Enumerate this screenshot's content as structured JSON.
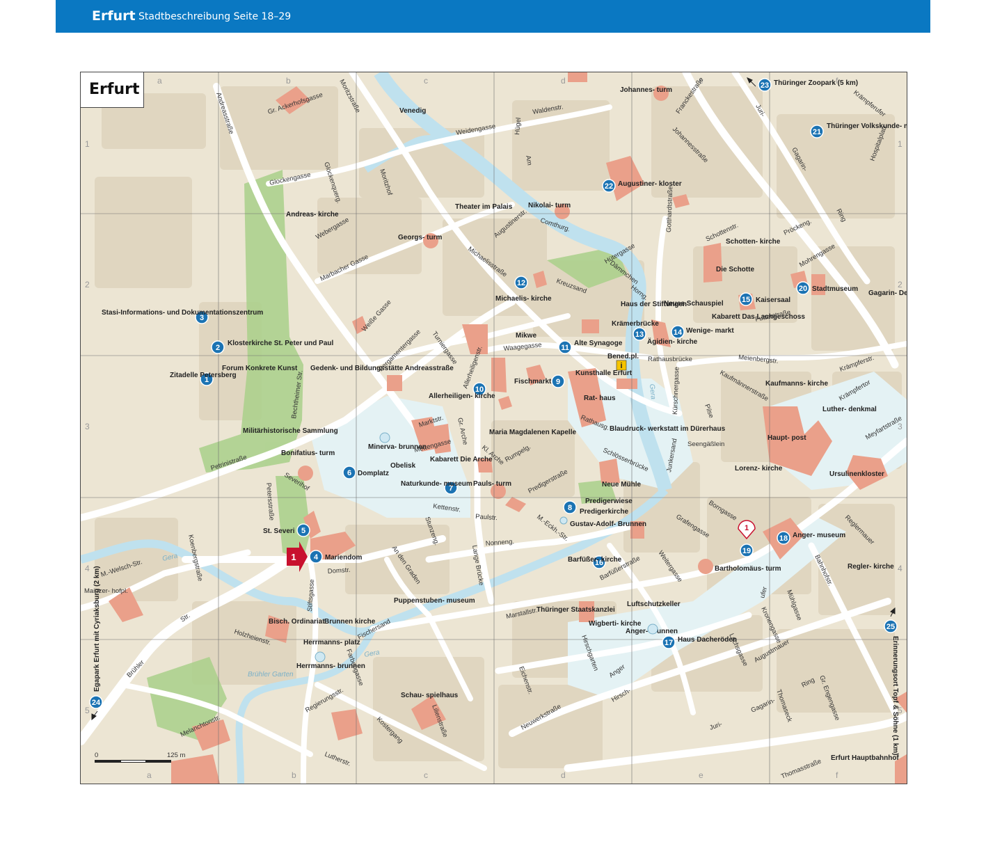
{
  "header": {
    "city": "Erfurt",
    "subtitle": "Stadtbeschreibung Seite 18–29"
  },
  "map": {
    "title": "Erfurt",
    "grid_columns": [
      "a",
      "b",
      "c",
      "d",
      "e",
      "f"
    ],
    "grid_rows": [
      "1",
      "2",
      "3",
      "4",
      "5"
    ],
    "scale": {
      "zero": "0",
      "max": "125 m"
    },
    "poi": [
      {
        "n": "1",
        "label": "Zitadelle Petersberg"
      },
      {
        "n": "2",
        "label": "Klosterkirche St. Peter und Paul"
      },
      {
        "n": "3",
        "label": "Stasi-Informations- und Dokumentationszentrum"
      },
      {
        "n": "4",
        "label": "Mariendom"
      },
      {
        "n": "5",
        "label": "St. Severi"
      },
      {
        "n": "6",
        "label": "Domplatz"
      },
      {
        "n": "7",
        "label": "Naturkunde- museum"
      },
      {
        "n": "8",
        "label": "Predigerkirche"
      },
      {
        "n": "9",
        "label": "Fischmarkt"
      },
      {
        "n": "10",
        "label": "Allerheiligen- kirche"
      },
      {
        "n": "11",
        "label": "Alte Synagoge"
      },
      {
        "n": "12",
        "label": "Michaelis- kirche"
      },
      {
        "n": "13",
        "label": "Krämerbrücke"
      },
      {
        "n": "14",
        "label": "Wenige- markt"
      },
      {
        "n": "15",
        "label": "Kaisersaal"
      },
      {
        "n": "16",
        "label": "Barfüßer- kirche"
      },
      {
        "n": "17",
        "label": "Haus Dacheröden"
      },
      {
        "n": "18",
        "label": "Anger- museum"
      },
      {
        "n": "19",
        "label": ""
      },
      {
        "n": "20",
        "label": "Stadtmuseum"
      },
      {
        "n": "21",
        "label": "Thüringer Volkskunde- museum"
      },
      {
        "n": "22",
        "label": "Augustiner- kloster"
      },
      {
        "n": "23",
        "label": "Thüringer Zoopark (5 km)"
      },
      {
        "n": "24",
        "label": "Egapark Erfurt mit Cyriaksburg (2 km)"
      },
      {
        "n": "25",
        "label": "Erinnerungsort Topf & Söhne (1 km)"
      }
    ],
    "places": {
      "venedig": "Venedig",
      "theater": "Theater im Palais",
      "andreaskirche": "Andreas- kirche",
      "georgsturm": "Georgs- turm",
      "nikolaiturm": "Nikolai- turm",
      "johannesturm": "Johannes- turm",
      "schottenkirche": "Schotten- kirche",
      "dieschotte": "Die Schotte",
      "hausstiftungen": "Haus der Stiftungen",
      "neuesschauspiel": "Neues Schauspiel",
      "kabarett": "Kabarett Das Lachgeschoss",
      "aegidien": "Ägidien- kirche",
      "mikwe": "Mikwe",
      "benedpl": "Bened.pl.",
      "kunsthalle": "Kunsthalle Erfurt",
      "rathaus": "Rat- haus",
      "blaudruck": "Blaudruck- werkstatt im Dürerhaus",
      "forum": "Forum Konkrete Kunst",
      "gedenk": "Gedenk- und Bildungsstätte Andreasstraße",
      "militaer": "Militärhistorische Sammlung",
      "bonifatius": "Bonifatius- turm",
      "minerva": "Minerva- brunnen",
      "obelisk": "Obelisk",
      "kabarettarche": "Kabarett Die Arche",
      "magdalenen": "Maria Magdalenen Kapelle",
      "paulsturm": "Pauls- turm",
      "neuemuehle": "Neue Mühle",
      "predigerwiese": "Predigerwiese",
      "gustavadolf": "Gustav-Adolf- Brunnen",
      "kaufmannskirche": "Kaufmanns- kirche",
      "lutherdenkmal": "Luther- denkmal",
      "hauptpost": "Haupt- post",
      "lorenzkirche": "Lorenz- kirche",
      "ursulinenkloster": "Ursulinenkloster",
      "bartholomaeus": "Bartholomäus- turm",
      "reglerkirche": "Regler- kirche",
      "luftschutz": "Luftschutzkeller",
      "staatskanzlei": "Thüringer Staatskanzlei",
      "wigberti": "Wigberti- kirche",
      "angerbrunnen": "Anger- brunnen",
      "puppenstuben": "Puppenstuben- museum",
      "bisch": "Bisch. Ordinariat",
      "brunnenkirche": "Brunnen kirche",
      "herrmannsplatz": "Herrmanns- platz",
      "herrmannsbrunnen": "Herrmanns- brunnen",
      "bruehlergarten": "Brühler Garten",
      "schauspielhaus": "Schau- spielhaus",
      "gagarin": "Gagarin- Denkmal",
      "mainzerhof": "Mainzer- hofpl.",
      "hbf": "Erfurt Hauptbahnhof",
      "seengaeßlein": "Seengäßlein"
    },
    "streets": [
      "Andreasstraße",
      "Gr. Ackerhofsgasse",
      "Moritzstraße",
      "Glockengasse",
      "Glockenquerg.",
      "Moritzhof",
      "Webergasse",
      "Marbacher Gasse",
      "Weiße Gasse",
      "Pergamentergasse",
      "Turniergasse",
      "Allerheiligenstr.",
      "Michaelisstraße",
      "Augustinerstr.",
      "Comthurg.",
      "Kreuzsand",
      "Waagegasse",
      "Weidengasse",
      "Waldenstr.",
      "Hügel",
      "Am",
      "Johannesstraße",
      "Franckestraße",
      "Gotthardtstraße",
      "Hütergasse",
      "Dämmchen",
      "Horng.",
      "Futterstraße",
      "Meienbergstr.",
      "Kaufmännerstraße",
      "Krämpferstr.",
      "Krämpfertor",
      "Meyfartstraße",
      "Juri-",
      "Gagarin-",
      "Ring",
      "Pröckeng.",
      "Schottenstr.",
      "Mohrengasse",
      "Hospitalplatz",
      "Krämpferufer",
      "Kürschnergasse",
      "Junkersand",
      "Schlösserbrücke",
      "Rathausbrücke",
      "Rathausg.",
      "Marktstr.",
      "Mettengasse",
      "Gr. Arche",
      "Kl. Arche",
      "Rumpelg.",
      "Predigerstraße",
      "Paulstr.",
      "Kettenstr.",
      "Stunzeng.",
      "Nonneng.",
      "M.-Eckh.-Str.",
      "Lange Brücke",
      "Domstr.",
      "An den Graden",
      "Severihof",
      "Petersstraße",
      "Petrinistraße",
      "Bechtheimer Str.",
      "Koenbergstraße",
      "M.-Welsch-Str.",
      "Brühler",
      "Str.",
      "Holzheienstr.",
      "Stiftsgasse",
      "Fischersand",
      "Farbengasse",
      "Regierungsstr.",
      "Melanchtonstr.",
      "Lutherstr.",
      "Kostergang",
      "Lilienstraße",
      "Neuwerkstraße",
      "Eichenstr.",
      "Marstallstr.",
      "Hirschgarten",
      "Anger",
      "Hirsch-",
      "Barfüßerstraße",
      "Weitergasse",
      "Grafengasse",
      "Borngasse",
      "Bahnhofstr.",
      "Reglermauer",
      "Mühlgasse",
      "Kronengasse",
      "Lachsgasse",
      "Augustmauer",
      "Thomasstraße",
      "Thomaseck",
      "Gr. Engengasse",
      "Pilse",
      "ufer",
      "Gera"
    ],
    "colors": {
      "land": "#ece5d3",
      "block": "#e0d6c0",
      "road": "#ffffff",
      "water": "#cfe8f2",
      "green": "#a9d08a",
      "landmark": "#eaa08a",
      "poi": "#1b73b3",
      "start": "#c8102e",
      "header": "#0a78c2"
    }
  }
}
